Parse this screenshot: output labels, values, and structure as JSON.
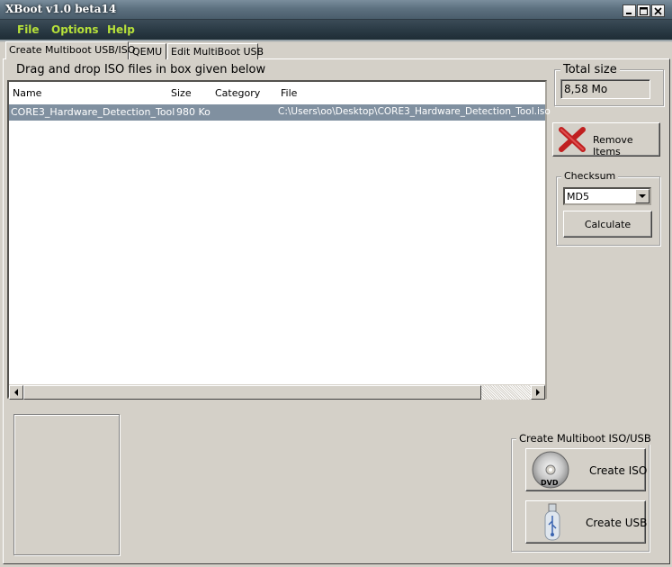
{
  "window": {
    "title": "XBoot v1.0 beta14"
  },
  "menu": {
    "file": "File",
    "options": "Options",
    "help": "Help"
  },
  "tabs": [
    {
      "label": "Create Multiboot USB/ISO",
      "active": true
    },
    {
      "label": "QEMU",
      "active": false
    },
    {
      "label": "Edit MultiBoot USB",
      "active": false
    }
  ],
  "main": {
    "drag_label": "Drag and drop ISO files in box given below",
    "columns": [
      "Name",
      "Size",
      "Category",
      "File"
    ],
    "rows": [
      {
        "name": "CORE3_Hardware_Detection_Tool",
        "size": "980 Ko",
        "category": "",
        "file": "C:\\Users\\oo\\Desktop\\CORE3_Hardware_Detection_Tool.iso"
      }
    ]
  },
  "total_size": {
    "title": "Total size",
    "value": "8,58 Mo"
  },
  "remove_button": "Remove Items",
  "checksum": {
    "title": "Checksum",
    "selected": "MD5",
    "calculate": "Calculate"
  },
  "create": {
    "title": "Create Multiboot ISO/USB",
    "iso_label": "Create ISO",
    "usb_label": "Create USB",
    "dvd_text": "DVD"
  },
  "colors": {
    "menu_text": "#b6e03a",
    "selection": "#8090a0",
    "remove_icon": "#c02020"
  }
}
